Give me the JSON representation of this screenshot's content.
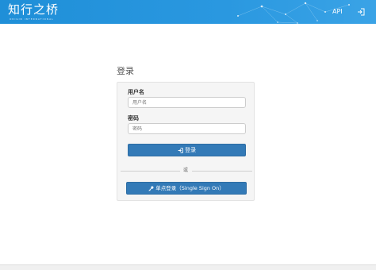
{
  "header": {
    "logo_text": "知行之桥",
    "logo_subtitle": "ORIGIN INTERNATIONAL",
    "nav_api": "API",
    "login_icon": "sign-in-icon",
    "bg_color": "#2a98e0"
  },
  "login": {
    "title": "登录",
    "username_label": "用户名",
    "username_placeholder": "用户名",
    "password_label": "密码",
    "password_placeholder": "密码",
    "login_button": "登录",
    "divider_text": "或",
    "sso_button": "单点登录（Single Sign On）",
    "accent_color": "#337ab7"
  }
}
